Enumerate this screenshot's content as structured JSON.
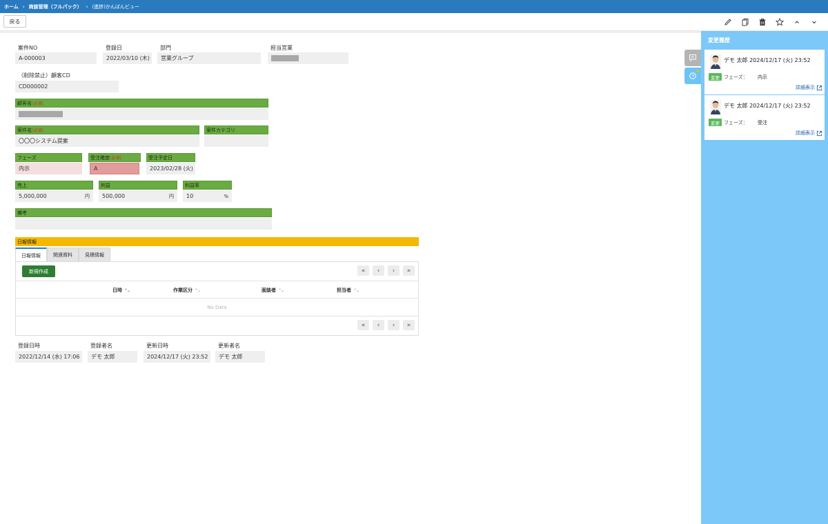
{
  "breadcrumb": {
    "home": "ホーム",
    "parent": "商談管理（フルパック）",
    "current": "(進捗)かんばんビュー",
    "sep": "›"
  },
  "toolbar": {
    "back_label": "戻る",
    "icons": [
      "pencil-icon",
      "copy-icon",
      "trash-icon",
      "star-icon",
      "chevron-up-icon",
      "chevron-down-icon"
    ]
  },
  "fields": {
    "case_no": {
      "label": "案件NO",
      "value": "A-000003"
    },
    "reg_date": {
      "label": "登録日",
      "value": "2022/03/10 (木)"
    },
    "dept": {
      "label": "部門",
      "value": "営業グループ"
    },
    "sales_rep": {
      "label": "担当営業",
      "value": ""
    },
    "customer_cd": {
      "label": "（削除禁止）顧客CD",
      "value": "CD000002"
    },
    "customer_name": {
      "label": "顧客名",
      "required": "[必須]",
      "value": ""
    },
    "case_name": {
      "label": "案件名",
      "required": "[必須]",
      "value": "〇〇〇システム提案"
    },
    "case_category": {
      "label": "案件カテゴリ",
      "value": ""
    },
    "phase": {
      "label": "フェーズ",
      "value": "内示"
    },
    "certainty": {
      "label": "受注確度",
      "required": "[必須]",
      "value": "A"
    },
    "order_date": {
      "label": "受注予定日",
      "value": "2023/02/28 (火)"
    },
    "sales": {
      "label": "売上",
      "value": "5,000,000",
      "unit": "円"
    },
    "profit": {
      "label": "利益",
      "value": "500,000",
      "unit": "円"
    },
    "profit_rate": {
      "label": "利益率",
      "value": "10",
      "unit": "%"
    },
    "notes": {
      "label": "備考",
      "value": ""
    }
  },
  "daily": {
    "section_title": "日報情報",
    "tabs": [
      "日報情報",
      "関連資料",
      "見積情報"
    ],
    "new_button": "新規作成",
    "columns": [
      "日時",
      "作業区分",
      "面談者",
      "担当者"
    ],
    "empty": "No Data",
    "pager": [
      "«",
      "‹",
      "›",
      "»"
    ]
  },
  "audit": {
    "created_at": {
      "label": "登録日時",
      "value": "2022/12/14 (水) 17:06"
    },
    "created_by": {
      "label": "登録者名",
      "value": "デモ 太郎"
    },
    "updated_at": {
      "label": "更新日時",
      "value": "2024/12/17 (火) 23:52"
    },
    "updated_by": {
      "label": "更新者名",
      "value": "デモ 太郎"
    }
  },
  "history": {
    "title": "変更履歴",
    "entries": [
      {
        "who": "デモ 太郎 2024/12/17 (火) 23:52",
        "badge": "変更",
        "field": "フェーズ：",
        "value": "内示",
        "link": "詳細表示"
      },
      {
        "who": "デモ 太郎 2024/12/17 (火) 23:52",
        "badge": "変更",
        "field": "フェーズ：",
        "value": "受注",
        "link": "詳細表示"
      }
    ]
  },
  "colors": {
    "topbar": "#2a7ac0",
    "green_label": "#6aab42",
    "section": "#f5b800",
    "history_bg": "#7cc8f8",
    "phase_bg": "#f5dede",
    "certainty_bg": "#e39c9c",
    "new_button": "#2e7d32"
  }
}
